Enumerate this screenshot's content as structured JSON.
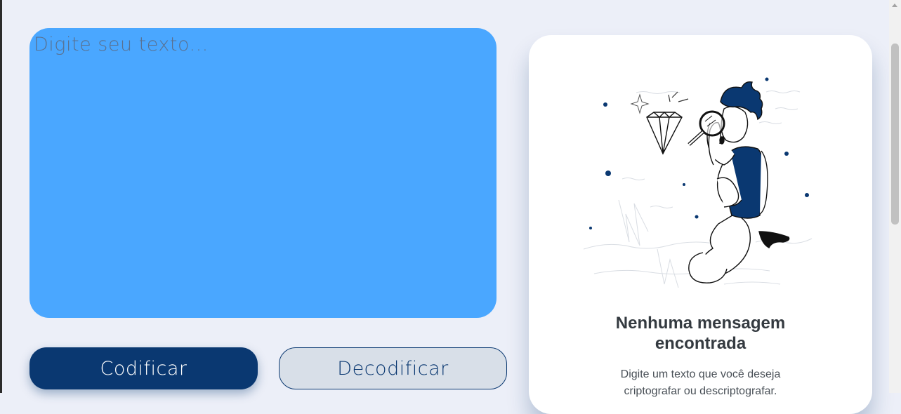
{
  "input": {
    "placeholder": "Digite seu texto...",
    "value": ""
  },
  "buttons": {
    "encode_label": "Codificar",
    "decode_label": "Decodificar"
  },
  "output_panel": {
    "title_line1": "Nenhuma mensagem",
    "title_line2": "encontrada",
    "text_line1": "Digite um texto que você deseja",
    "text_line2": "criptografar ou descriptografar."
  },
  "colors": {
    "page_background": "#eceff8",
    "input_background": "#4aa7ff",
    "primary": "#0a3871",
    "secondary_button": "#d8dfe8",
    "panel_background": "#ffffff"
  },
  "icons": {
    "illustration": "person-searching-diamond-illustration"
  }
}
